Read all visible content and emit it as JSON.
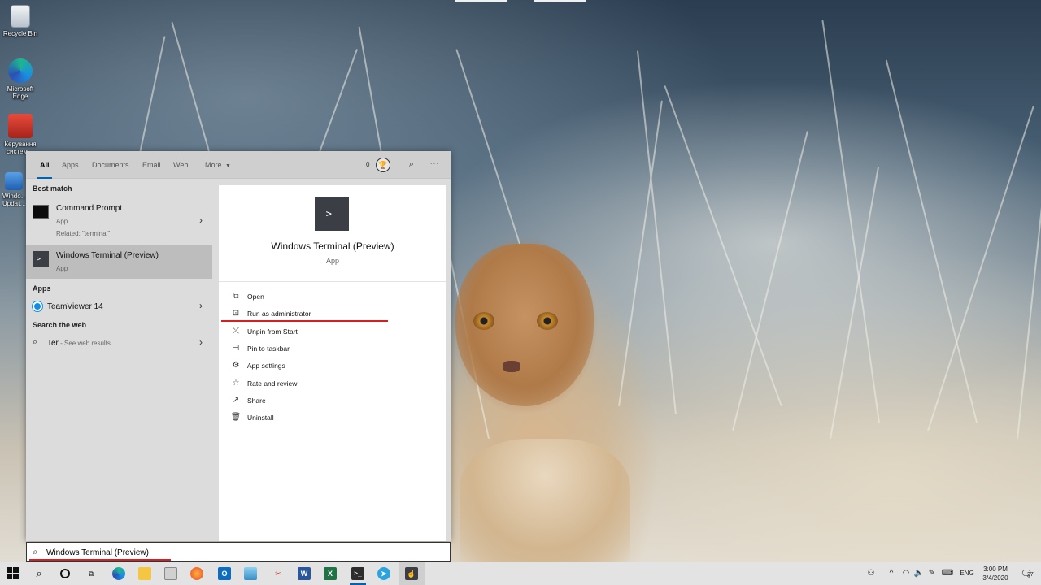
{
  "desktop": {
    "icons": [
      {
        "label": "Recycle Bin",
        "icon": "recycle-bin-icon"
      },
      {
        "label": "Microsoft Edge",
        "icon": "edge-icon"
      },
      {
        "label": "Керування систем…",
        "icon": "toolbox-icon"
      },
      {
        "label": "Windo… Updat…",
        "icon": "windows-update-icon"
      }
    ]
  },
  "search": {
    "filters": [
      "All",
      "Apps",
      "Documents",
      "Email",
      "Web",
      "More"
    ],
    "active_filter": "All",
    "rewards_count": "0",
    "more_icon": "ellipsis-icon",
    "best_match_heading": "Best match",
    "best_match": [
      {
        "title": "Command Prompt",
        "type": "App",
        "related": "Related: \"terminal\""
      },
      {
        "title": "Windows Terminal (Preview)",
        "type": "App"
      }
    ],
    "apps_heading": "Apps",
    "apps": [
      {
        "title": "TeamViewer 14"
      }
    ],
    "web_heading": "Search the web",
    "web": [
      {
        "query": "Ter",
        "suffix": " - See web results"
      }
    ],
    "detail": {
      "title": "Windows Terminal (Preview)",
      "type": "App",
      "actions": [
        {
          "label": "Open",
          "icon": "open-icon"
        },
        {
          "label": "Run as administrator",
          "icon": "run-as-admin-icon"
        },
        {
          "label": "Unpin from Start",
          "icon": "unpin-icon"
        },
        {
          "label": "Pin to taskbar",
          "icon": "pin-icon"
        },
        {
          "label": "App settings",
          "icon": "gear-icon"
        },
        {
          "label": "Rate and review",
          "icon": "star-icon"
        },
        {
          "label": "Share",
          "icon": "share-icon"
        },
        {
          "label": "Uninstall",
          "icon": "trash-icon"
        }
      ]
    },
    "query": "Windows Terminal (Preview)"
  },
  "taskbar": {
    "pinned": [
      "start-icon",
      "search-icon",
      "cortana-icon",
      "task-view-icon",
      "edge-icon",
      "explorer-icon",
      "store-icon",
      "firefox-icon",
      "outlook-icon",
      "app-icon",
      "snip-icon",
      "word-icon",
      "excel-icon",
      "terminal-icon",
      "telegram-icon",
      "pointer-app-icon"
    ],
    "tray": {
      "language": "ENG",
      "time": "3:00 PM",
      "date": "3/4/2020",
      "notifications": "27"
    }
  },
  "colors": {
    "accent": "#0063b1",
    "highlight_underline": "#d81f1f"
  }
}
